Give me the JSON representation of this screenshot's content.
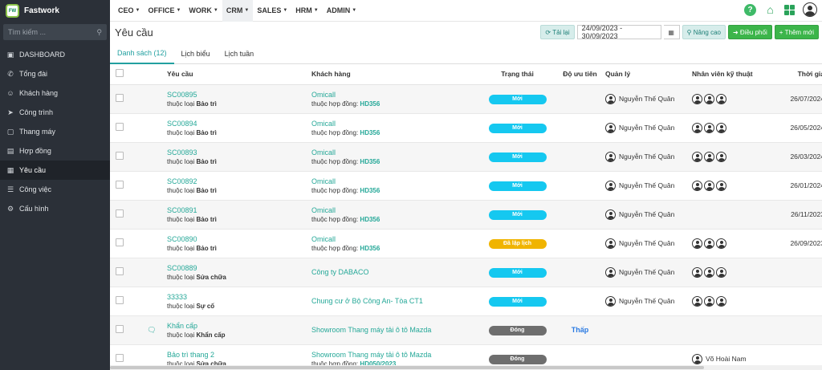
{
  "app": {
    "name": "Fastwork",
    "logo_text": "FW"
  },
  "sidebar": {
    "search_placeholder": "Tìm kiếm ...",
    "items": [
      {
        "label": "DASHBOARD",
        "icon": "monitor-icon"
      },
      {
        "label": "Tổng đài",
        "icon": "phone-icon"
      },
      {
        "label": "Khách hàng",
        "icon": "users-icon"
      },
      {
        "label": "Công trình",
        "icon": "send-icon"
      },
      {
        "label": "Thang máy",
        "icon": "box-icon"
      },
      {
        "label": "Hợp đồng",
        "icon": "file-icon"
      },
      {
        "label": "Yêu cầu",
        "icon": "calendar-icon"
      },
      {
        "label": "Công việc",
        "icon": "list-icon"
      },
      {
        "label": "Cấu hình",
        "icon": "gear-icon"
      }
    ]
  },
  "topmenu": [
    {
      "label": "CEO"
    },
    {
      "label": "OFFICE"
    },
    {
      "label": "WORK"
    },
    {
      "label": "CRM"
    },
    {
      "label": "SALES"
    },
    {
      "label": "HRM"
    },
    {
      "label": "ADMIN"
    }
  ],
  "page": {
    "title": "Yêu cầu"
  },
  "toolbar": {
    "reload_label": "Tải lại",
    "date_range": "24/09/2023 - 30/09/2023",
    "advanced_label": "Nâng cao",
    "dispatch_label": "Điều phối",
    "add_label": "Thêm mới"
  },
  "tabs": [
    {
      "label": "Danh sách (12)"
    },
    {
      "label": "Lịch biểu"
    },
    {
      "label": "Lịch tuần"
    }
  ],
  "table": {
    "headers": {
      "request": "Yêu cầu",
      "customer": "Khách hàng",
      "status": "Trạng thái",
      "priority": "Độ ưu tiên",
      "manager": "Quản lý",
      "technicians": "Nhân viên kỹ thuật",
      "time": "Thời gia"
    },
    "rows": [
      {
        "code": "SC00895",
        "type_prefix": "thuộc loại",
        "type": "Bảo trì",
        "customer": "Omicall",
        "contract_prefix": "thuộc hợp đồng:",
        "contract": "HD356",
        "status": "Mới",
        "status_kind": "new",
        "priority": "",
        "manager": "Nguyễn Thế Quân",
        "tech_count": 3,
        "date": "26/07/2024",
        "chat": false
      },
      {
        "code": "SC00894",
        "type_prefix": "thuộc loại",
        "type": "Bảo trì",
        "customer": "Omicall",
        "contract_prefix": "thuộc hợp đồng:",
        "contract": "HD356",
        "status": "Mới",
        "status_kind": "new",
        "priority": "",
        "manager": "Nguyễn Thế Quân",
        "tech_count": 3,
        "date": "26/05/2024",
        "chat": false
      },
      {
        "code": "SC00893",
        "type_prefix": "thuộc loại",
        "type": "Bảo trì",
        "customer": "Omicall",
        "contract_prefix": "thuộc hợp đồng:",
        "contract": "HD356",
        "status": "Mới",
        "status_kind": "new",
        "priority": "",
        "manager": "Nguyễn Thế Quân",
        "tech_count": 3,
        "date": "26/03/2024",
        "chat": false
      },
      {
        "code": "SC00892",
        "type_prefix": "thuộc loại",
        "type": "Bảo trì",
        "customer": "Omicall",
        "contract_prefix": "thuộc hợp đồng:",
        "contract": "HD356",
        "status": "Mới",
        "status_kind": "new",
        "priority": "",
        "manager": "Nguyễn Thế Quân",
        "tech_count": 3,
        "date": "26/01/2024",
        "chat": false
      },
      {
        "code": "SC00891",
        "type_prefix": "thuộc loại",
        "type": "Bảo trì",
        "customer": "Omicall",
        "contract_prefix": "thuộc hợp đồng:",
        "contract": "HD356",
        "status": "Mới",
        "status_kind": "new",
        "priority": "",
        "manager": "Nguyễn Thế Quân",
        "tech_count": 0,
        "date": "26/11/2023",
        "chat": false
      },
      {
        "code": "SC00890",
        "type_prefix": "thuộc loại",
        "type": "Bảo trì",
        "customer": "Omicall",
        "contract_prefix": "thuộc hợp đồng:",
        "contract": "HD356",
        "status": "Đã lập lịch",
        "status_kind": "sched",
        "priority": "",
        "manager": "Nguyễn Thế Quân",
        "tech_count": 3,
        "date": "26/09/2023",
        "chat": false
      },
      {
        "code": "SC00889",
        "type_prefix": "thuộc loại",
        "type": "Sửa chữa",
        "customer": "Công ty DABACO",
        "contract_prefix": "",
        "contract": "",
        "status": "Mới",
        "status_kind": "new",
        "priority": "",
        "manager": "Nguyễn Thế Quân",
        "tech_count": 3,
        "date": "",
        "chat": false
      },
      {
        "code": "33333",
        "type_prefix": "thuộc loại",
        "type": "Sự cố",
        "customer": "Chung cư ở Bộ Công An- Tòa CT1",
        "contract_prefix": "",
        "contract": "",
        "status": "Mới",
        "status_kind": "new",
        "priority": "",
        "manager": "Nguyễn Thế Quân",
        "tech_count": 3,
        "date": "",
        "chat": false
      },
      {
        "code": "Khẩn cấp",
        "type_prefix": "thuộc loại",
        "type": "Khẩn cấp",
        "customer": "Showroom Thang máy tải ô tô Mazda",
        "contract_prefix": "",
        "contract": "",
        "status": "Đóng",
        "status_kind": "closed",
        "priority": "Thấp",
        "manager": "",
        "tech_count": 0,
        "date": "",
        "chat": true
      },
      {
        "code": "Bảo trì thang 2",
        "type_prefix": "thuộc loại",
        "type": "Sửa chữa",
        "customer": "Showroom Thang máy tải ô tô Mazda",
        "contract_prefix": "thuộc hợp đồng:",
        "contract": "HD050/2023",
        "status": "Đóng",
        "status_kind": "closed",
        "priority": "",
        "manager": "",
        "tech_count": 0,
        "tech_name": "Võ Hoài Nam",
        "date": "",
        "chat": false
      }
    ]
  }
}
